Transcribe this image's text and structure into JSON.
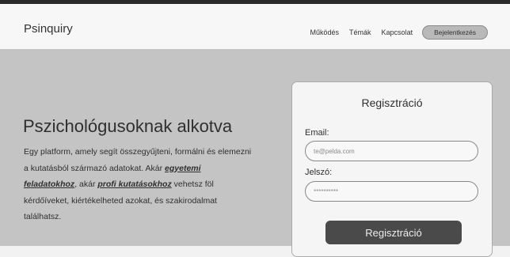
{
  "header": {
    "brand": "Psinquiry",
    "nav": [
      "Működés",
      "Témák",
      "Kapcsolat"
    ],
    "login_label": "Bejelentkezés"
  },
  "hero": {
    "title": "Pszichológusoknak alkotva",
    "desc_1": "Egy platform, amely segít összegyűjteni, formálni és elemezni a kutatásból származó adatokat. Akár ",
    "link_1": "egyetemi feladatokhoz",
    "desc_2": ", akár ",
    "link_2": "profi kutatásokhoz",
    "desc_3": " vehetsz föl kérdőíveket, kiértékelheted azokat, és szakirodalmat találhatsz."
  },
  "register": {
    "title": "Regisztráció",
    "email_label": "Email:",
    "email_placeholder": "te@pelda.com",
    "password_label": "Jelszó:",
    "password_placeholder": "**********",
    "submit_label": "Regisztráció"
  }
}
